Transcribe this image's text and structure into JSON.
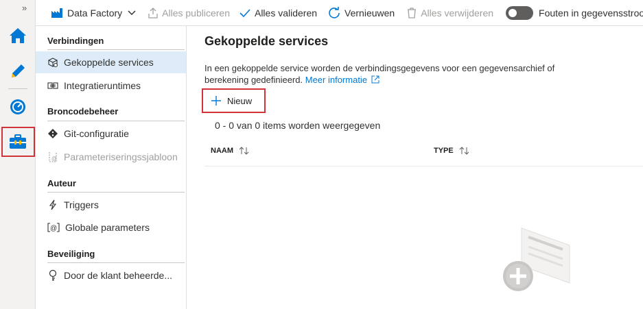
{
  "toolbar": {
    "factory_label": "Data Factory",
    "publish_label": "Alles publiceren",
    "validate_label": "Alles valideren",
    "refresh_label": "Vernieuwen",
    "delete_label": "Alles verwijderen",
    "dataflow_toggle_label": "Fouten in gegevensstroom"
  },
  "subnav": {
    "sections": [
      {
        "title": "Verbindingen",
        "items": [
          "Gekoppelde services",
          "Integratieruntimes"
        ]
      },
      {
        "title": "Broncodebeheer",
        "items": [
          "Git-configuratie",
          "Parameteriseringssjabloon"
        ]
      },
      {
        "title": "Auteur",
        "items": [
          "Triggers",
          "Globale parameters"
        ]
      },
      {
        "title": "Beveiliging",
        "items": [
          "Door de klant beheerde..."
        ]
      }
    ]
  },
  "main": {
    "title": "Gekoppelde services",
    "description": "In een gekoppelde service worden de verbindingsgegevens voor een gegevensarchief of berekening gedefinieerd.",
    "learn_more": "Meer informatie",
    "new_label": "Nieuw",
    "items_count": "0 - 0 van 0 items worden weergegeven",
    "columns": [
      "NAAM",
      "TYPE"
    ]
  },
  "colors": {
    "accent": "#0078d4",
    "highlight": "#d13438",
    "active_bg": "#deecf9"
  }
}
